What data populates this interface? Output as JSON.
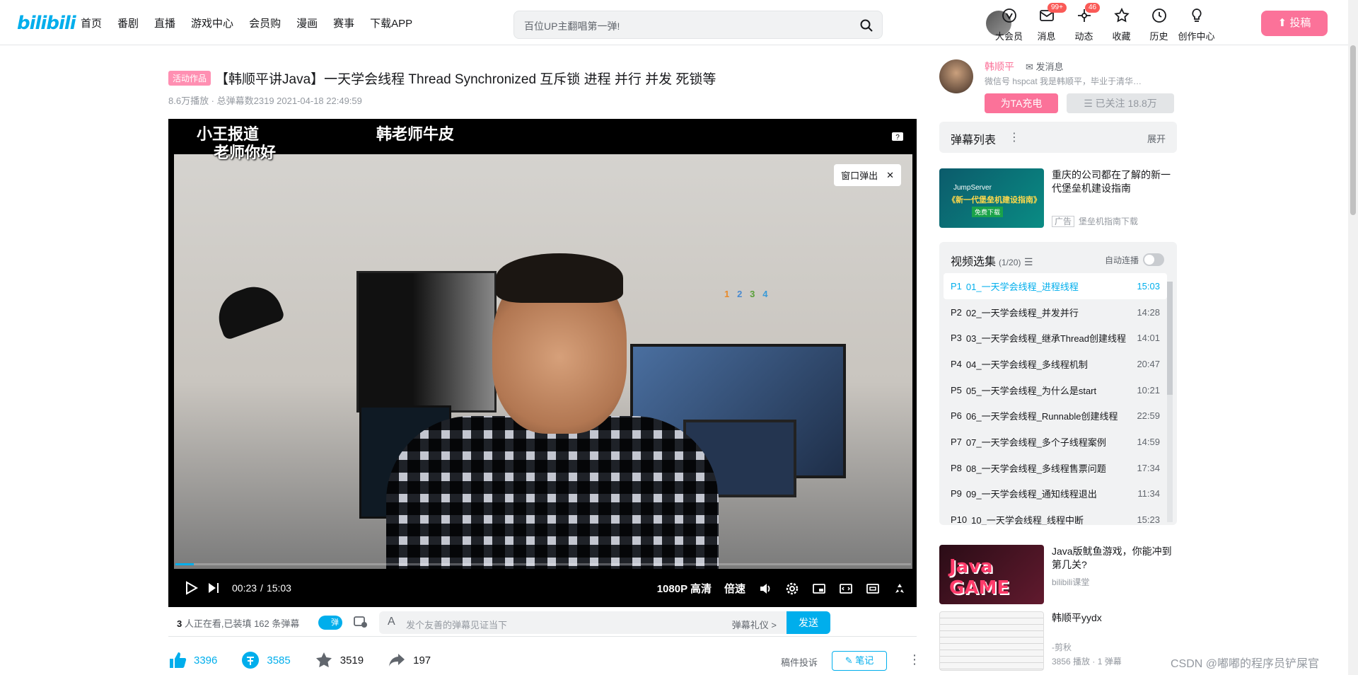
{
  "header": {
    "logo": "bilibili",
    "nav": [
      "首页",
      "番剧",
      "直播",
      "游戏中心",
      "会员购",
      "漫画",
      "赛事",
      "下载APP"
    ],
    "search_placeholder": "百位UP主翻唱第一弹!",
    "icons": [
      {
        "label": "大会员",
        "icon": "vip-icon"
      },
      {
        "label": "消息",
        "icon": "message-icon",
        "badge": "99+"
      },
      {
        "label": "动态",
        "icon": "dynamic-icon",
        "badge": "46"
      },
      {
        "label": "收藏",
        "icon": "star-icon"
      },
      {
        "label": "历史",
        "icon": "history-icon"
      },
      {
        "label": "创作中心",
        "icon": "creator-icon"
      }
    ],
    "upload_label": "投稿"
  },
  "video": {
    "tag": "活动作品",
    "title": "【韩顺平讲Java】一天学会线程 Thread Synchronized 互斥锁 进程 并行 并发 死锁等",
    "meta": "8.6万播放 · 总弹幕数2319    2021-04-18 22:49:59",
    "danmaku": [
      "小王报道",
      "老师你好",
      "韩老师牛皮"
    ],
    "popout_label": "窗口弹出",
    "current_time": "00:23",
    "duration": "15:03",
    "progress": 0.025,
    "quality": "1080P 高清",
    "speed": "倍速"
  },
  "sendbar": {
    "info_count": "3",
    "info_text": " 人正在看,已装填 162 条弹幕",
    "toggle": "弹",
    "placeholder": "发个友善的弹幕见证当下",
    "etiquette": "弹幕礼仪 >",
    "send": "发送"
  },
  "actions": {
    "like": "3396",
    "coin": "3585",
    "favorite": "3519",
    "share": "197",
    "report": "稿件投诉",
    "note": "笔记"
  },
  "up": {
    "name": "韩顺平",
    "message": "发消息",
    "desc": "微信号 hspcat 我是韩顺平，毕业于清华大学, ...",
    "charge": "为TA充电",
    "followed": "已关注 18.8万"
  },
  "danmaku_list": {
    "title": "弹幕列表",
    "expand": "展开"
  },
  "ad": {
    "title": "重庆的公司都在了解的新一代堡垒机建设指南",
    "tag": "广告",
    "source": "堡垒机指南下载",
    "img_brand": "JumpServer",
    "img_title": "《新一代堡垒机建设指南》",
    "img_btn": "免费下载"
  },
  "playlist": {
    "title": "视频选集",
    "count": "(1/20)",
    "autoplay": "自动连播",
    "items": [
      {
        "p": "P1",
        "name": "01_一天学会线程_进程线程",
        "dur": "15:03"
      },
      {
        "p": "P2",
        "name": "02_一天学会线程_并发并行",
        "dur": "14:28"
      },
      {
        "p": "P3",
        "name": "03_一天学会线程_继承Thread创建线程",
        "dur": "14:01"
      },
      {
        "p": "P4",
        "name": "04_一天学会线程_多线程机制",
        "dur": "20:47"
      },
      {
        "p": "P5",
        "name": "05_一天学会线程_为什么是start",
        "dur": "10:21"
      },
      {
        "p": "P6",
        "name": "06_一天学会线程_Runnable创建线程",
        "dur": "22:59"
      },
      {
        "p": "P7",
        "name": "07_一天学会线程_多个子线程案例",
        "dur": "14:59"
      },
      {
        "p": "P8",
        "name": "08_一天学会线程_多线程售票问题",
        "dur": "17:34"
      },
      {
        "p": "P9",
        "name": "09_一天学会线程_通知线程退出",
        "dur": "11:34"
      },
      {
        "p": "P10",
        "name": "10_一天学会线程_线程中断",
        "dur": "15:23"
      }
    ]
  },
  "recommend": [
    {
      "title": "Java版鱿鱼游戏，你能冲到第几关?",
      "up": "bilibili课堂",
      "stats": "",
      "thumb_text": "Java GAME"
    },
    {
      "title": "韩顺平yydx",
      "up": "-剪秋",
      "stats": "3856 播放 · 1 弹幕",
      "thumb_text": ""
    }
  ],
  "watermark": "CSDN @嘟嘟的程序员铲屎官"
}
